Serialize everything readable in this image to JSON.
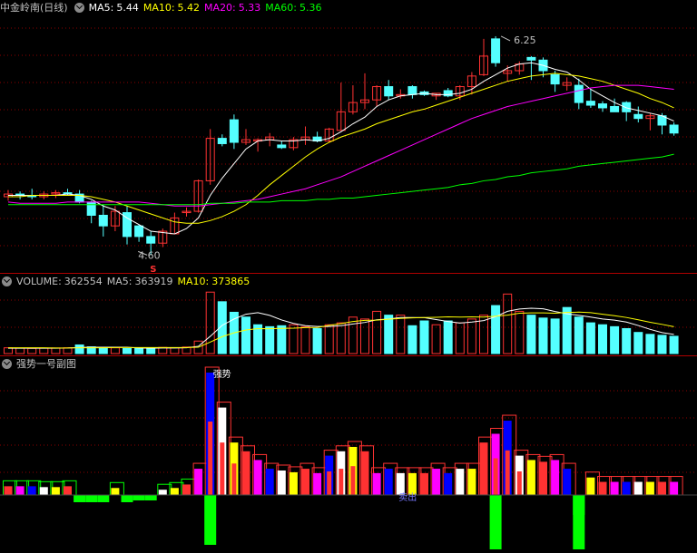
{
  "main": {
    "title": "中金岭南(日线)",
    "ma5_label": "MA5:",
    "ma5_value": "5.44",
    "ma10_label": "MA10:",
    "ma10_value": "5.42",
    "ma20_label": "MA20:",
    "ma20_value": "5.33",
    "ma60_label": "MA60:",
    "ma60_value": "5.36",
    "high_label": "6.25",
    "low_label": "4.60",
    "signal_marker": "S"
  },
  "volume": {
    "label": "VOLUME:",
    "value": "362554",
    "ma5_label": "MA5:",
    "ma5_value": "363919",
    "ma10_label": "MA10:",
    "ma10_value": "373865"
  },
  "indicator": {
    "title": "强势一号副图",
    "strong_label": "强势",
    "sell_label": "卖出"
  },
  "colors": {
    "up": "#ff3232",
    "down": "#54ffff",
    "ma5": "#ffffff",
    "ma10": "#ffff00",
    "ma20": "#ff00ff",
    "ma60": "#00ff00",
    "grid": "#8b0000",
    "separator": "#b00000",
    "text": "#c0c0c0",
    "bar_blue": "#0000ff",
    "bar_magenta": "#ff00ff",
    "bar_green": "#00ff00"
  },
  "chart_data": [
    {
      "type": "candlestick",
      "title": "中金岭南(日线)",
      "ylim": [
        4.5,
        6.4
      ],
      "grid": true,
      "candles": [
        {
          "o": 5.04,
          "h": 5.09,
          "l": 5.01,
          "c": 5.06
        },
        {
          "o": 5.06,
          "h": 5.08,
          "l": 5.02,
          "c": 5.05
        },
        {
          "o": 5.05,
          "h": 5.1,
          "l": 5.02,
          "c": 5.04
        },
        {
          "o": 5.04,
          "h": 5.08,
          "l": 5.02,
          "c": 5.06
        },
        {
          "o": 5.06,
          "h": 5.09,
          "l": 5.03,
          "c": 5.07
        },
        {
          "o": 5.07,
          "h": 5.1,
          "l": 5.05,
          "c": 5.06
        },
        {
          "o": 5.06,
          "h": 5.09,
          "l": 4.99,
          "c": 5.0
        },
        {
          "o": 5.0,
          "h": 5.01,
          "l": 4.84,
          "c": 4.9
        },
        {
          "o": 4.9,
          "h": 4.98,
          "l": 4.74,
          "c": 4.82
        },
        {
          "o": 4.82,
          "h": 4.97,
          "l": 4.78,
          "c": 4.93
        },
        {
          "o": 4.92,
          "h": 4.97,
          "l": 4.68,
          "c": 4.74
        },
        {
          "o": 4.82,
          "h": 4.83,
          "l": 4.7,
          "c": 4.74
        },
        {
          "o": 4.74,
          "h": 4.78,
          "l": 4.6,
          "c": 4.69
        },
        {
          "o": 4.69,
          "h": 4.8,
          "l": 4.66,
          "c": 4.78
        },
        {
          "o": 4.76,
          "h": 4.92,
          "l": 4.76,
          "c": 4.88
        },
        {
          "o": 4.92,
          "h": 4.96,
          "l": 4.89,
          "c": 4.93
        },
        {
          "o": 4.93,
          "h": 5.17,
          "l": 4.92,
          "c": 5.16
        },
        {
          "o": 5.16,
          "h": 5.55,
          "l": 5.13,
          "c": 5.48
        },
        {
          "o": 5.48,
          "h": 5.51,
          "l": 5.42,
          "c": 5.44
        },
        {
          "o": 5.62,
          "h": 5.66,
          "l": 5.4,
          "c": 5.45
        },
        {
          "o": 5.45,
          "h": 5.55,
          "l": 5.43,
          "c": 5.47
        },
        {
          "o": 5.46,
          "h": 5.48,
          "l": 5.38,
          "c": 5.47
        },
        {
          "o": 5.47,
          "h": 5.52,
          "l": 5.42,
          "c": 5.49
        },
        {
          "o": 5.43,
          "h": 5.46,
          "l": 5.4,
          "c": 5.41
        },
        {
          "o": 5.41,
          "h": 5.49,
          "l": 5.39,
          "c": 5.47
        },
        {
          "o": 5.47,
          "h": 5.57,
          "l": 5.43,
          "c": 5.49
        },
        {
          "o": 5.49,
          "h": 5.53,
          "l": 5.45,
          "c": 5.46
        },
        {
          "o": 5.46,
          "h": 5.56,
          "l": 5.45,
          "c": 5.55
        },
        {
          "o": 5.54,
          "h": 5.9,
          "l": 5.54,
          "c": 5.68
        },
        {
          "o": 5.68,
          "h": 5.88,
          "l": 5.66,
          "c": 5.75
        },
        {
          "o": 5.75,
          "h": 5.97,
          "l": 5.7,
          "c": 5.77
        },
        {
          "o": 5.77,
          "h": 5.88,
          "l": 5.72,
          "c": 5.87
        },
        {
          "o": 5.87,
          "h": 5.92,
          "l": 5.77,
          "c": 5.8
        },
        {
          "o": 5.8,
          "h": 5.85,
          "l": 5.78,
          "c": 5.81
        },
        {
          "o": 5.87,
          "h": 5.88,
          "l": 5.78,
          "c": 5.81
        },
        {
          "o": 5.83,
          "h": 5.84,
          "l": 5.8,
          "c": 5.81
        },
        {
          "o": 5.8,
          "h": 5.82,
          "l": 5.77,
          "c": 5.82
        },
        {
          "o": 5.84,
          "h": 5.86,
          "l": 5.79,
          "c": 5.8
        },
        {
          "o": 5.8,
          "h": 5.88,
          "l": 5.77,
          "c": 5.87
        },
        {
          "o": 5.87,
          "h": 5.98,
          "l": 5.81,
          "c": 5.95
        },
        {
          "o": 5.96,
          "h": 6.23,
          "l": 5.95,
          "c": 6.1
        },
        {
          "o": 6.23,
          "h": 6.25,
          "l": 6.02,
          "c": 6.05
        },
        {
          "o": 5.97,
          "h": 6.03,
          "l": 5.91,
          "c": 5.99
        },
        {
          "o": 5.99,
          "h": 6.06,
          "l": 5.96,
          "c": 6.04
        },
        {
          "o": 6.09,
          "h": 6.1,
          "l": 5.92,
          "c": 6.07
        },
        {
          "o": 6.07,
          "h": 6.09,
          "l": 5.94,
          "c": 5.99
        },
        {
          "o": 5.96,
          "h": 5.99,
          "l": 5.83,
          "c": 5.89
        },
        {
          "o": 5.88,
          "h": 5.94,
          "l": 5.84,
          "c": 5.9
        },
        {
          "o": 5.88,
          "h": 5.93,
          "l": 5.7,
          "c": 5.75
        },
        {
          "o": 5.76,
          "h": 5.85,
          "l": 5.71,
          "c": 5.73
        },
        {
          "o": 5.74,
          "h": 5.76,
          "l": 5.68,
          "c": 5.71
        },
        {
          "o": 5.72,
          "h": 5.78,
          "l": 5.68,
          "c": 5.68
        },
        {
          "o": 5.75,
          "h": 5.76,
          "l": 5.61,
          "c": 5.68
        },
        {
          "o": 5.66,
          "h": 5.72,
          "l": 5.6,
          "c": 5.63
        },
        {
          "o": 5.63,
          "h": 5.67,
          "l": 5.54,
          "c": 5.65
        },
        {
          "o": 5.65,
          "h": 5.67,
          "l": 5.51,
          "c": 5.58
        },
        {
          "o": 5.58,
          "h": 5.6,
          "l": 5.5,
          "c": 5.52
        }
      ],
      "series": [
        {
          "name": "MA5",
          "values": [
            5.05,
            5.05,
            5.05,
            5.05,
            5.05,
            5.06,
            5.05,
            5.02,
            4.97,
            4.94,
            4.88,
            4.83,
            4.78,
            4.77,
            4.76,
            4.8,
            4.88,
            5.05,
            5.18,
            5.29,
            5.4,
            5.46,
            5.47,
            5.46,
            5.46,
            5.47,
            5.46,
            5.48,
            5.53,
            5.59,
            5.64,
            5.72,
            5.77,
            5.8,
            5.81,
            5.82,
            5.81,
            5.81,
            5.82,
            5.85,
            5.91,
            5.96,
            6.01,
            6.04,
            6.05,
            6.03,
            6.0,
            5.98,
            5.92,
            5.85,
            5.8,
            5.75,
            5.71,
            5.69,
            5.67,
            5.65,
            5.61
          ]
        },
        {
          "name": "MA10",
          "values": [
            5.04,
            5.04,
            5.05,
            5.05,
            5.05,
            5.05,
            5.05,
            5.04,
            5.02,
            5.0,
            4.97,
            4.94,
            4.91,
            4.88,
            4.85,
            4.84,
            4.84,
            4.86,
            4.89,
            4.93,
            4.98,
            5.05,
            5.13,
            5.2,
            5.27,
            5.34,
            5.4,
            5.45,
            5.49,
            5.52,
            5.55,
            5.59,
            5.62,
            5.65,
            5.68,
            5.7,
            5.73,
            5.76,
            5.79,
            5.82,
            5.85,
            5.88,
            5.91,
            5.93,
            5.95,
            5.96,
            5.97,
            5.96,
            5.95,
            5.93,
            5.91,
            5.88,
            5.85,
            5.82,
            5.78,
            5.75,
            5.71
          ]
        },
        {
          "name": "MA20",
          "values": [
            5.0,
            4.99,
            4.99,
            4.99,
            4.99,
            5.0,
            5.0,
            5.0,
            5.0,
            5.0,
            5.0,
            5.0,
            4.99,
            4.98,
            4.97,
            4.97,
            4.97,
            4.98,
            4.99,
            5.0,
            5.01,
            5.02,
            5.04,
            5.06,
            5.08,
            5.1,
            5.13,
            5.16,
            5.19,
            5.23,
            5.27,
            5.31,
            5.35,
            5.39,
            5.43,
            5.47,
            5.51,
            5.55,
            5.59,
            5.63,
            5.66,
            5.69,
            5.72,
            5.74,
            5.76,
            5.78,
            5.8,
            5.82,
            5.84,
            5.86,
            5.87,
            5.88,
            5.88,
            5.88,
            5.87,
            5.86,
            5.85
          ]
        },
        {
          "name": "MA60",
          "values": [
            4.98,
            4.98,
            4.98,
            4.98,
            4.98,
            4.98,
            4.98,
            4.98,
            4.98,
            4.98,
            4.98,
            4.98,
            4.98,
            4.98,
            4.98,
            4.98,
            4.98,
            4.99,
            4.99,
            4.99,
            5.0,
            5.0,
            5.0,
            5.01,
            5.01,
            5.01,
            5.02,
            5.02,
            5.03,
            5.03,
            5.04,
            5.05,
            5.06,
            5.07,
            5.08,
            5.09,
            5.1,
            5.11,
            5.13,
            5.14,
            5.16,
            5.17,
            5.19,
            5.2,
            5.22,
            5.23,
            5.24,
            5.25,
            5.27,
            5.28,
            5.29,
            5.3,
            5.31,
            5.32,
            5.33,
            5.34,
            5.36
          ]
        }
      ]
    },
    {
      "type": "bar",
      "title": "VOLUME",
      "values": [
        30,
        28,
        27,
        28,
        29,
        30,
        45,
        35,
        28,
        30,
        26,
        28,
        28,
        32,
        30,
        34,
        65,
        320,
        270,
        215,
        190,
        150,
        140,
        145,
        150,
        140,
        130,
        150,
        160,
        190,
        180,
        220,
        200,
        200,
        145,
        170,
        150,
        170,
        160,
        180,
        200,
        250,
        310,
        220,
        200,
        185,
        180,
        240,
        190,
        160,
        150,
        140,
        130,
        110,
        100,
        95,
        90
      ],
      "up": [
        true,
        true,
        true,
        true,
        true,
        true,
        false,
        false,
        false,
        true,
        false,
        false,
        false,
        true,
        true,
        true,
        true,
        true,
        false,
        false,
        false,
        false,
        false,
        false,
        true,
        true,
        false,
        true,
        true,
        true,
        true,
        true,
        false,
        true,
        false,
        false,
        true,
        false,
        true,
        true,
        true,
        false,
        true,
        true,
        false,
        false,
        false,
        false,
        false,
        false,
        false,
        false,
        false,
        false,
        false,
        false,
        false
      ],
      "series": [
        {
          "name": "MA5",
          "values": [
            28,
            28,
            28,
            28,
            28,
            29,
            32,
            33,
            33,
            33,
            33,
            29,
            28,
            29,
            29,
            30,
            38,
            90,
            147,
            180,
            205,
            213,
            199,
            175,
            157,
            145,
            141,
            141,
            145,
            154,
            162,
            176,
            180,
            188,
            188,
            187,
            177,
            167,
            159,
            164,
            172,
            192,
            220,
            232,
            236,
            233,
            219,
            207,
            199,
            190,
            180,
            174,
            164,
            146,
            126,
            109,
            100
          ]
        },
        {
          "name": "MA10",
          "values": [
            30,
            30,
            30,
            30,
            29,
            29,
            30,
            30,
            30,
            31,
            31,
            31,
            31,
            31,
            31,
            31,
            33,
            60,
            88,
            108,
            123,
            130,
            129,
            131,
            132,
            135,
            136,
            147,
            156,
            167,
            173,
            174,
            179,
            183,
            186,
            188,
            189,
            191,
            190,
            191,
            190,
            195,
            200,
            210,
            212,
            212,
            210,
            214,
            216,
            213,
            205,
            197,
            188,
            176,
            163,
            152,
            140
          ]
        }
      ]
    },
    {
      "type": "bar",
      "title": "强势一号副图",
      "values": [
        10,
        10,
        10,
        9,
        9,
        10,
        -8,
        -8,
        -8,
        8,
        -8,
        -6,
        -6,
        6,
        8,
        12,
        30,
        140,
        100,
        60,
        50,
        40,
        30,
        28,
        26,
        30,
        25,
        45,
        50,
        55,
        50,
        25,
        30,
        25,
        25,
        25,
        30,
        25,
        30,
        30,
        60,
        70,
        85,
        45,
        40,
        38,
        40,
        30,
        -20,
        20,
        15,
        15,
        15,
        15,
        15,
        15,
        15
      ]
    }
  ]
}
